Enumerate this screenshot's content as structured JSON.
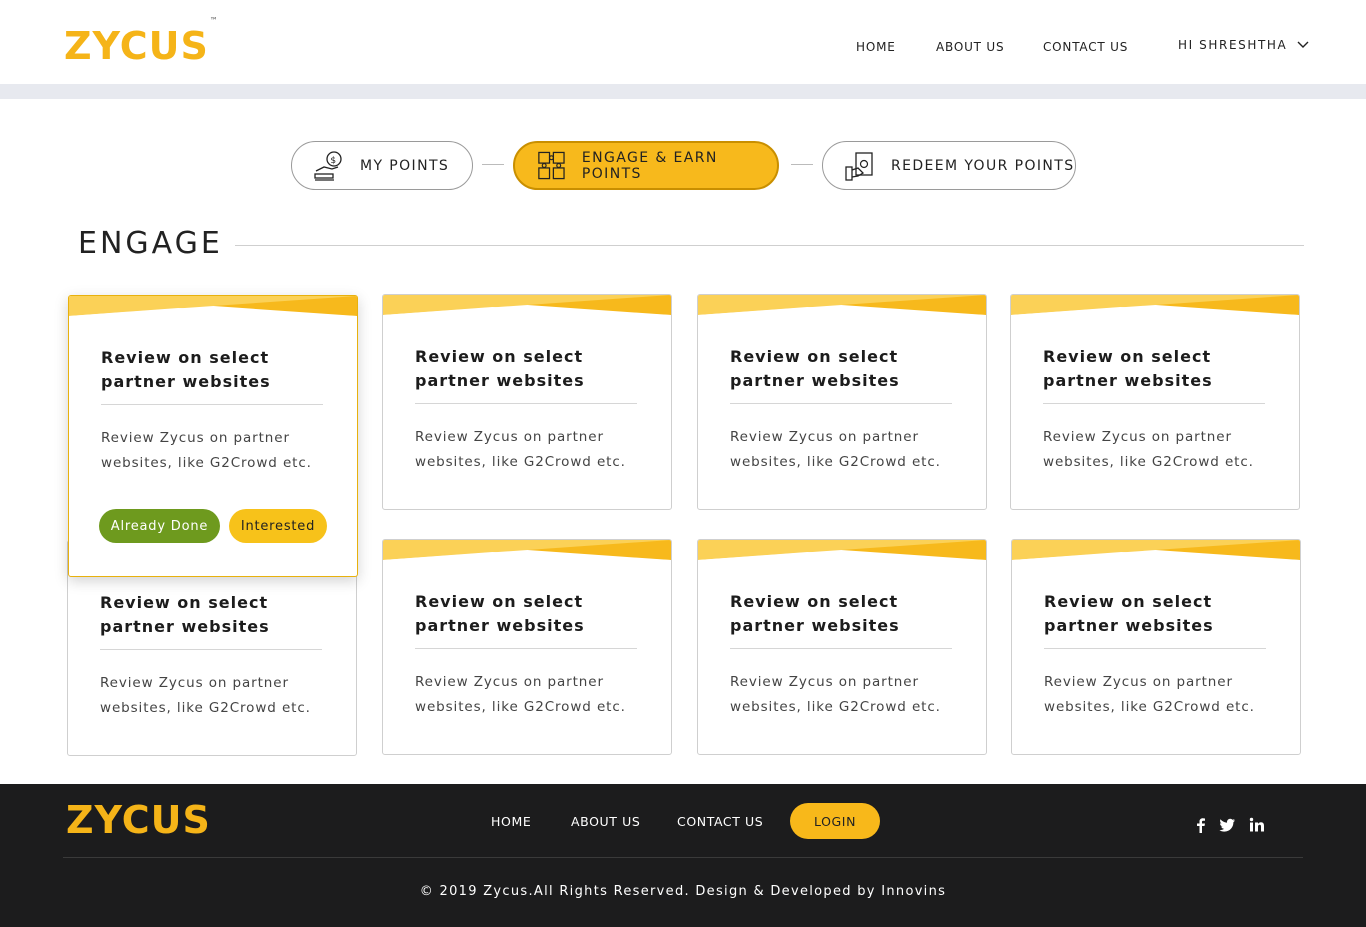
{
  "brand": {
    "logo_text": "ZYCUS",
    "trademark": "™",
    "accent": "#f7b91c"
  },
  "header": {
    "nav": [
      "HOME",
      "ABOUT US",
      "CONTACT US"
    ],
    "user_greeting": "HI SHRESHTHA"
  },
  "steps": [
    {
      "label": "MY POINTS",
      "icon": "hand-coin-icon",
      "active": false
    },
    {
      "label": "ENGAGE & EARN POINTS",
      "icon": "puzzle-grid-icon",
      "active": true
    },
    {
      "label": "REDEEM YOUR POINTS",
      "icon": "cash-hand-icon",
      "active": false
    }
  ],
  "section": {
    "title": "ENGAGE"
  },
  "cards": [
    {
      "title": "Review on select partner websites",
      "description": "Review Zycus on partner websites, like G2Crowd etc."
    },
    {
      "title": "Review on select partner websites",
      "description": "Review Zycus on partner websites, like G2Crowd etc."
    },
    {
      "title": "Review on select partner websites",
      "description": "Review Zycus on partner websites, like G2Crowd etc."
    },
    {
      "title": "Review on select partner websites",
      "description": "Review Zycus on partner websites, like G2Crowd etc."
    },
    {
      "title": "Review on select partner websites",
      "description": "Review Zycus on partner websites, like G2Crowd etc."
    },
    {
      "title": "Review on select partner websites",
      "description": "Review Zycus on partner websites, like G2Crowd etc."
    },
    {
      "title": "Review on select partner websites",
      "description": "Review Zycus on partner websites, like G2Crowd etc."
    },
    {
      "title": "Review on select partner websites",
      "description": "Review Zycus on partner websites, like G2Crowd etc."
    }
  ],
  "card_actions": {
    "done_label": "Already Done",
    "interested_label": "Interested",
    "done_color": "#6e9a1e",
    "interested_color": "#f7c21a"
  },
  "footer": {
    "nav": [
      "HOME",
      "ABOUT US",
      "CONTACT US"
    ],
    "login_label": "LOGIN",
    "social": [
      "facebook-icon",
      "twitter-icon",
      "linkedin-icon"
    ],
    "copyright": "© 2019 Zycus.All Rights Reserved. Design & Developed by Innovins"
  }
}
